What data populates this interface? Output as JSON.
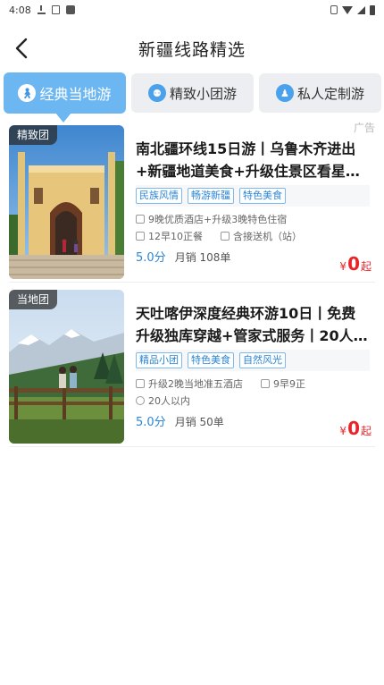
{
  "status_bar": {
    "time": "4:08"
  },
  "nav": {
    "title": "新疆线路精选",
    "back_icon": "chevron-left-icon"
  },
  "tabs": [
    {
      "label": "经典当地游",
      "icon": "walker-icon",
      "active": true
    },
    {
      "label": "精致小团游",
      "icon": "group-icon",
      "active": false
    },
    {
      "label": "私人定制游",
      "icon": "custom-icon",
      "active": false
    }
  ],
  "ad_label": "广告",
  "products": [
    {
      "badge": "精致团",
      "title": "南北疆环线15日游丨乌鲁木齐进出+新疆地道美食+升级住景区看星…",
      "tags": [
        "民族风情",
        "畅游新疆",
        "特色美食"
      ],
      "hotel": "9晚优质酒店+升级3晚特色住宿",
      "meal": "12早10正餐",
      "transfer": "含接送机（站）",
      "score": "5.0分",
      "sales": "月销 108单",
      "price_currency": "¥",
      "price": "0",
      "price_suffix": "起"
    },
    {
      "badge": "当地团",
      "title": "天吐喀伊深度经典环游10日丨免费升级独库穿越+管家式服务丨20人…",
      "tags": [
        "精品小团",
        "特色美食",
        "自然风光"
      ],
      "hotel": "升级2晚当地准五酒店",
      "meal": "9早9正",
      "group": "20人以内",
      "score": "5.0分",
      "sales": "月销 50单",
      "price_currency": "¥",
      "price": "0",
      "price_suffix": "起"
    }
  ],
  "colors": {
    "accent": "#6cb7f2",
    "price": "#e8242b",
    "tag": "#2b86d6"
  }
}
